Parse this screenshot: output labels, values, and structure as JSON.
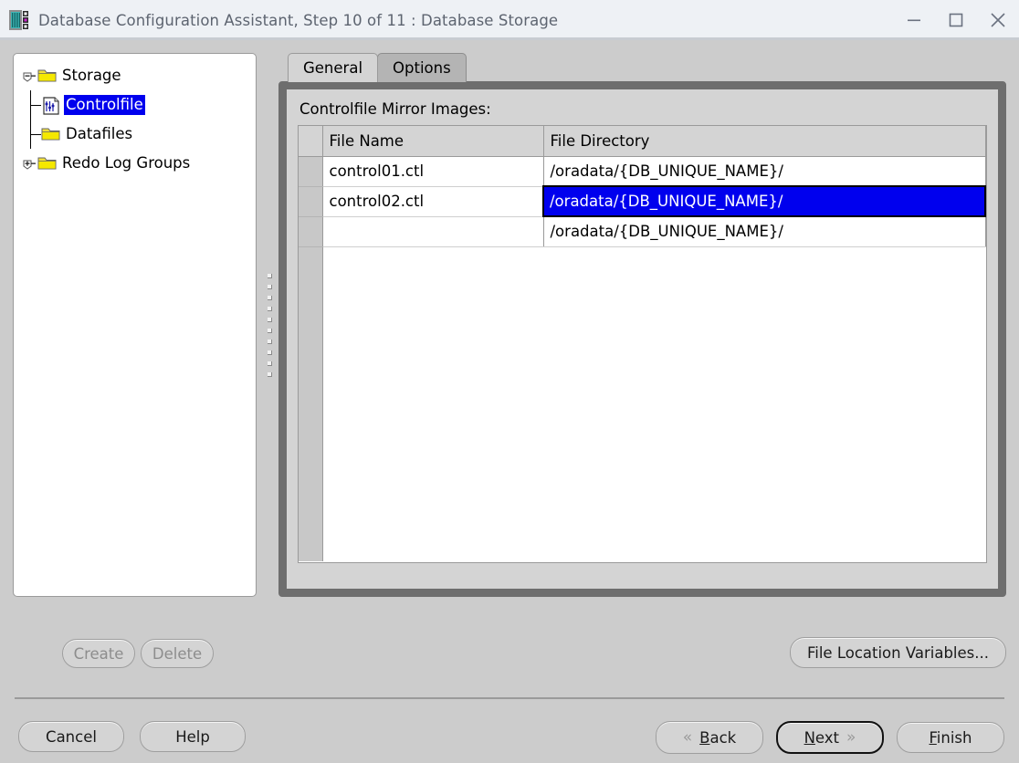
{
  "window": {
    "title": "Database Configuration Assistant, Step 10 of 11 : Database Storage",
    "icon": "database-icon",
    "controls": {
      "minimize": "minimize-icon",
      "maximize": "maximize-icon",
      "close": "close-icon"
    }
  },
  "tree": {
    "nodes": [
      {
        "label": "Storage",
        "icon": "folder-icon",
        "handle": "collapse-handle",
        "selected": false,
        "level": 0
      },
      {
        "label": "Controlfile",
        "icon": "controlfile-icon",
        "handle": "none",
        "selected": true,
        "level": 1
      },
      {
        "label": "Datafiles",
        "icon": "folder-icon",
        "handle": "none",
        "selected": false,
        "level": 1
      },
      {
        "label": "Redo Log Groups",
        "icon": "folder-icon",
        "handle": "expand-handle",
        "selected": false,
        "level": 0
      }
    ]
  },
  "tabs": [
    {
      "label": "General",
      "active": true
    },
    {
      "label": "Options",
      "active": false
    }
  ],
  "panel": {
    "section_label": "Controlfile Mirror Images:"
  },
  "table": {
    "columns": [
      "File Name",
      "File Directory"
    ],
    "rows": [
      {
        "file_name": "control01.ctl",
        "file_directory": "/oradata/{DB_UNIQUE_NAME}/",
        "selected_cell": null
      },
      {
        "file_name": "control02.ctl",
        "file_directory": "/oradata/{DB_UNIQUE_NAME}/",
        "selected_cell": "file_directory"
      },
      {
        "file_name": "",
        "file_directory": "/oradata/{DB_UNIQUE_NAME}/",
        "selected_cell": null
      }
    ]
  },
  "actions": {
    "create": "Create",
    "delete": "Delete",
    "file_location_variables": "File Location Variables..."
  },
  "navigation": {
    "cancel": "Cancel",
    "help": "Help",
    "back": "Back",
    "next": "Next",
    "finish": "Finish",
    "back_mnemonic": "B",
    "next_mnemonic": "N",
    "finish_mnemonic": "F",
    "back_rest": "ack",
    "next_rest": "ext",
    "finish_rest": "inish"
  },
  "colors": {
    "selection": "#0000ee",
    "titlebar": "#eef1f5",
    "panel": "#d4d4d4",
    "window": "#cccccc"
  }
}
